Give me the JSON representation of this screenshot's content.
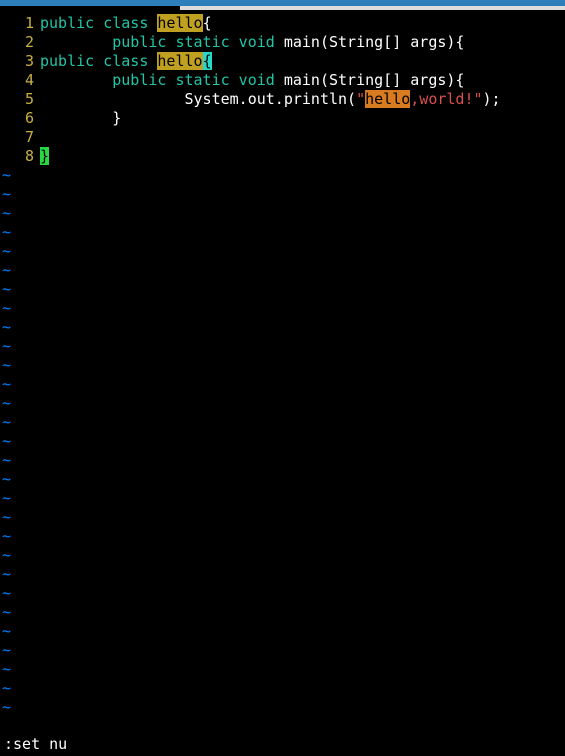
{
  "editor": {
    "lines": [
      {
        "n": "1",
        "segments": [
          {
            "cls": "kw-type",
            "t": "public class "
          },
          {
            "cls": "hl-word",
            "t": "hello"
          },
          {
            "cls": "",
            "t": "{"
          }
        ]
      },
      {
        "n": "2",
        "segments": [
          {
            "cls": "",
            "t": "        "
          },
          {
            "cls": "kw-type",
            "t": "public static void "
          },
          {
            "cls": "",
            "t": "main(String[] args){"
          }
        ]
      },
      {
        "n": "3",
        "segments": [
          {
            "cls": "kw-type",
            "t": "public class "
          },
          {
            "cls": "hl-word",
            "t": "hello"
          },
          {
            "cls": "cursor-block",
            "t": "{"
          }
        ]
      },
      {
        "n": "4",
        "segments": [
          {
            "cls": "",
            "t": "        "
          },
          {
            "cls": "kw-type",
            "t": "public static void "
          },
          {
            "cls": "",
            "t": "main(String[] args){"
          }
        ]
      },
      {
        "n": "5",
        "segments": [
          {
            "cls": "",
            "t": "                System.out.println("
          },
          {
            "cls": "string",
            "t": "\""
          },
          {
            "cls": "hl-word-orange",
            "t": "hello"
          },
          {
            "cls": "string",
            "t": ",world!\""
          },
          {
            "cls": "",
            "t": ");"
          }
        ]
      },
      {
        "n": "6",
        "segments": [
          {
            "cls": "",
            "t": "        }"
          }
        ]
      },
      {
        "n": "7",
        "segments": [
          {
            "cls": "",
            "t": ""
          }
        ]
      },
      {
        "n": "8",
        "segments": [
          {
            "cls": "green-block",
            "t": "}"
          }
        ]
      }
    ],
    "tilde": "~",
    "tilde_count": 29
  },
  "cmdline": ":set nu"
}
